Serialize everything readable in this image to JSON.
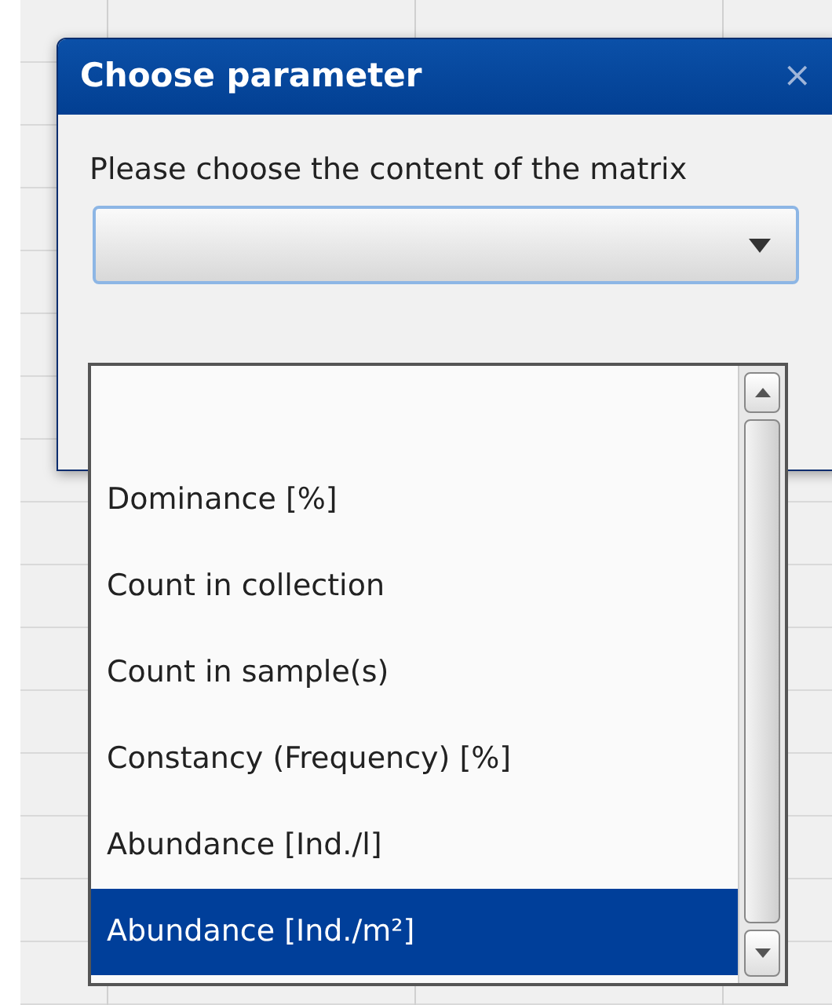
{
  "dialog": {
    "title": "Choose parameter",
    "close": "×",
    "prompt": "Please choose the content of the matrix"
  },
  "dropdown": {
    "options": [
      {
        "label": "Dominance [%]",
        "selected": false
      },
      {
        "label": "Count in collection",
        "selected": false
      },
      {
        "label": "Count in sample(s)",
        "selected": false
      },
      {
        "label": "Constancy (Frequency) [%]",
        "selected": false
      },
      {
        "label": "Abundance [Ind./l]",
        "selected": false
      },
      {
        "label": "Abundance [Ind./m²]",
        "selected": true
      }
    ]
  }
}
